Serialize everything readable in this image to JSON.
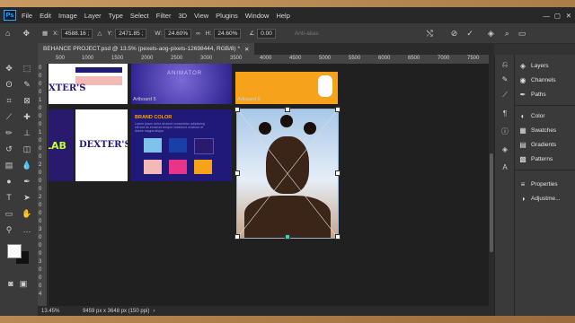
{
  "menu": [
    "File",
    "Edit",
    "Image",
    "Layer",
    "Type",
    "Select",
    "Filter",
    "3D",
    "View",
    "Plugins",
    "Window",
    "Help"
  ],
  "app_logo": "Ps",
  "options": {
    "x_label": "X:",
    "x_value": "4588.16 ;",
    "y_label": "Y:",
    "y_value": "2471.85 ;",
    "w_label": "W:",
    "w_value": "24.60%",
    "h_label": "H:",
    "h_value": "24.60%",
    "angle_value": "0.00",
    "antialias": "Anti-alias"
  },
  "document_tab": "BEHANCE PROJECT.psd @ 13.5% (pexels-aog-pixels-12698444, RGB/8) *",
  "ruler_h": [
    "500",
    "1000",
    "1500",
    "2000",
    "2500",
    "3000",
    "3500",
    "4000",
    "4500",
    "5000",
    "5500",
    "6000",
    "6500",
    "7000",
    "7500"
  ],
  "ruler_v": [
    "0",
    "0",
    "0",
    "0",
    "1",
    "0",
    "0",
    "0",
    "1",
    "0",
    "0",
    "0",
    "2",
    "0",
    "0",
    "0",
    "2",
    "0",
    "0",
    "0",
    "3",
    "0",
    "0",
    "0",
    "3",
    "0",
    "0",
    "0",
    "4"
  ],
  "artboards": {
    "artboard5_label": "Artboard 5",
    "artboard6_label": "Artboard 6",
    "animator_text": "ANIMATOR",
    "dexters_small": "XTER'S",
    "dexters_big": "DEXTER'S",
    "lab_text": "LAB",
    "brand_color_title": "BRAND COLOR",
    "brand_color_body": "Lorem ipsum dolor sit amet consectetur adipiscing elit sed do eiusmod tempor incididunt ut labore et dolore magna aliqua"
  },
  "status": {
    "zoom": "13.45%",
    "doc_size": "9459 px x 3648 px (150 ppi)"
  },
  "panels": [
    {
      "icon": "layers-icon",
      "label": "Layers"
    },
    {
      "icon": "channels-icon",
      "label": "Channels"
    },
    {
      "icon": "paths-icon",
      "label": "Paths"
    },
    {
      "icon": "color-icon",
      "label": "Color"
    },
    {
      "icon": "swatches-icon",
      "label": "Swatches"
    },
    {
      "icon": "gradients-icon",
      "label": "Gradients"
    },
    {
      "icon": "patterns-icon",
      "label": "Patterns"
    },
    {
      "icon": "properties-icon",
      "label": "Properties"
    },
    {
      "icon": "adjustments-icon",
      "label": "Adjustme..."
    }
  ],
  "colors": {
    "brand_swatches": [
      "#7fc3ea",
      "#1a3fa8",
      "#2a1a6e",
      "#f4b8b6",
      "#e8358a",
      "#f6a21a"
    ],
    "orange": "#f6a21a",
    "navy": "#1f1a7a"
  }
}
